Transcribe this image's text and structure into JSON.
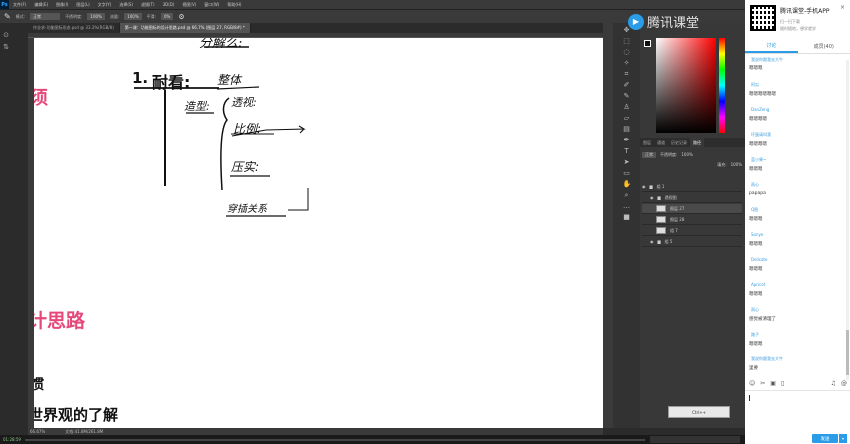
{
  "photoshop": {
    "logo": "Ps",
    "menu": [
      "文件(F)",
      "编辑(E)",
      "图像(I)",
      "图层(L)",
      "文字(Y)",
      "选择(S)",
      "滤镜(T)",
      "3D(D)",
      "视图(V)",
      "窗口(W)",
      "帮助(H)"
    ],
    "options": {
      "mode_label": "模式:",
      "mode_value": "正常",
      "opacity_label": "不透明度:",
      "opacity_value": "100%",
      "flow_label": "流量:",
      "flow_value": "100%",
      "smooth_label": "平滑:",
      "smooth_value": "0%"
    },
    "tabs": [
      {
        "label": "作业求-功能图标形态.psd @ 33.3%(RGB/8)",
        "active": false
      },
      {
        "label": "第一课：功能图标的设计思路.psd @ 66.7% (图层 27, RGB/8#) *",
        "active": true
      }
    ],
    "canvas": {
      "top_handwriting": "分解么:",
      "heading_number": "1.",
      "heading": "耐看:",
      "heading_note": "整体",
      "sub_label": "造型:",
      "item1": "透视:",
      "item2": "比例:",
      "item3": "压实:",
      "item4": "穿插关系",
      "left_pink_1": "须",
      "left_pink_2": "计思路",
      "left_dark_1": "惯",
      "left_dark_2": "世界观的了解"
    },
    "status": {
      "zoom": "66.67%",
      "doc": "文档:41.8M/261.8M"
    },
    "panel_tabs": [
      "图层",
      "通道",
      "历史记录",
      "路径"
    ],
    "blend_mode": "正常",
    "opacity_label": "不透明度:",
    "opacity_value": "100%",
    "fill_label": "填充:",
    "fill_value": "100%",
    "layers": [
      {
        "name": "组 1"
      },
      {
        "name": "透视图"
      },
      {
        "name": "图层 27"
      },
      {
        "name": "图层 28"
      },
      {
        "name": "组 7"
      },
      {
        "name": "组 5"
      }
    ],
    "ctrl_button": "Ctrl++",
    "taskbar_time": "01:28:59"
  },
  "watermark": {
    "text": "腾讯课堂"
  },
  "chat": {
    "app_title": "腾讯课堂-手机APP",
    "app_sub1": "扫一扫下载",
    "app_sub2": "随时随地，想学就学",
    "tabs": [
      {
        "label": "讨论",
        "active": true
      },
      {
        "label": "成员(40)",
        "active": false
      }
    ],
    "messages": [
      {
        "name": "我说你跟我去大牛",
        "text": "嗯嗯嗯"
      },
      {
        "name": "阿瓜",
        "text": "嗯嗯嗯嗯嗯嗯"
      },
      {
        "name": "DanZeng",
        "text": "嗯嗯嗯嗯"
      },
      {
        "name": "坏蛋请叫我",
        "text": "嗯嗯嗯嗯"
      },
      {
        "name": "蓝小果~",
        "text": "嗯嗯嗯"
      },
      {
        "name": "雨心",
        "text": "papapa"
      },
      {
        "name": "Q图",
        "text": "嗯嗯嗯"
      },
      {
        "name": "Sonye",
        "text": "嗯嗯嗯"
      },
      {
        "name": "Delicate",
        "text": "嗯嗯嗯"
      },
      {
        "name": "Apricot",
        "text": "嗯嗯嗯"
      },
      {
        "name": "雨心",
        "text": "感觉被清理了"
      },
      {
        "name": "路子",
        "text": "嗯嗯嗯"
      },
      {
        "name": "我说你跟我去大牛",
        "text": "里要"
      }
    ],
    "send_label": "发送"
  }
}
